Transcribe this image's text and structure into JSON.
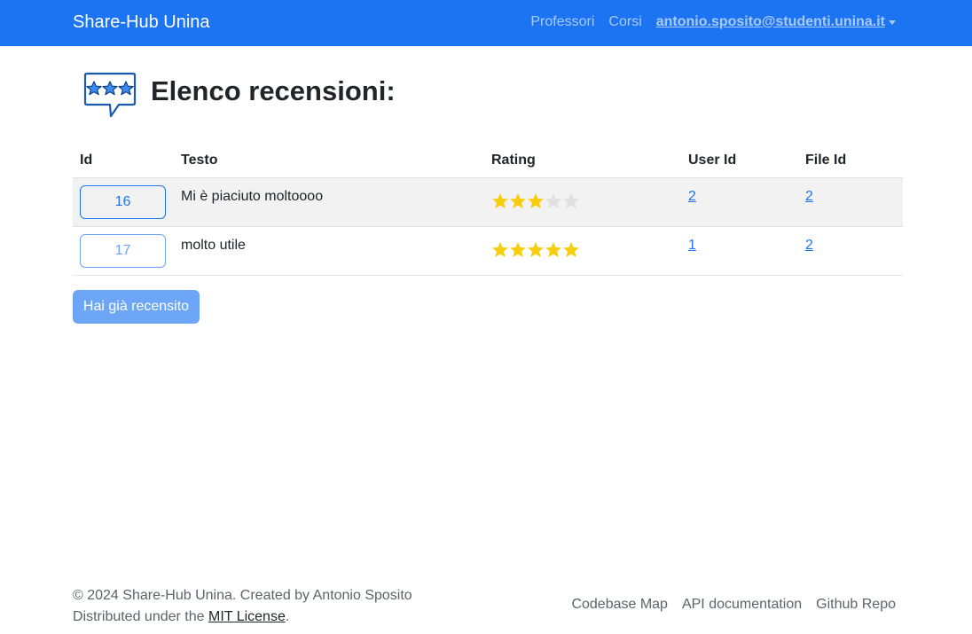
{
  "navbar": {
    "brand": "Share-Hub Unina",
    "links": [
      "Professori",
      "Corsi"
    ],
    "user": "antonio.sposito@studenti.unina.it"
  },
  "page": {
    "title": "Elenco recensioni:",
    "icon": "rating-stars-speech-icon"
  },
  "table": {
    "headers": [
      "Id",
      "Testo",
      "Rating",
      "User Id",
      "File Id"
    ],
    "rows": [
      {
        "id": "16",
        "text": "Mi è piaciuto moltoooo",
        "rating": 3,
        "max_rating": 5,
        "user_id": "2",
        "file_id": "2"
      },
      {
        "id": "17",
        "text": "molto utile",
        "rating": 5,
        "max_rating": 5,
        "user_id": "1",
        "file_id": "2"
      }
    ]
  },
  "review_button": "Hai già recensito",
  "footer": {
    "copyright": "© 2024 Share-Hub Unina. Created by Antonio Sposito",
    "license_prefix": "Distributed under the ",
    "license_link": "MIT License",
    "license_suffix": ".",
    "links": [
      "Codebase Map",
      "API documentation",
      "Github Repo"
    ]
  },
  "colors": {
    "primary": "#1c74f2",
    "star_filled": "#f7ce0e",
    "star_empty": "#e0e0e0",
    "striped_row": "#f2f2f2"
  }
}
